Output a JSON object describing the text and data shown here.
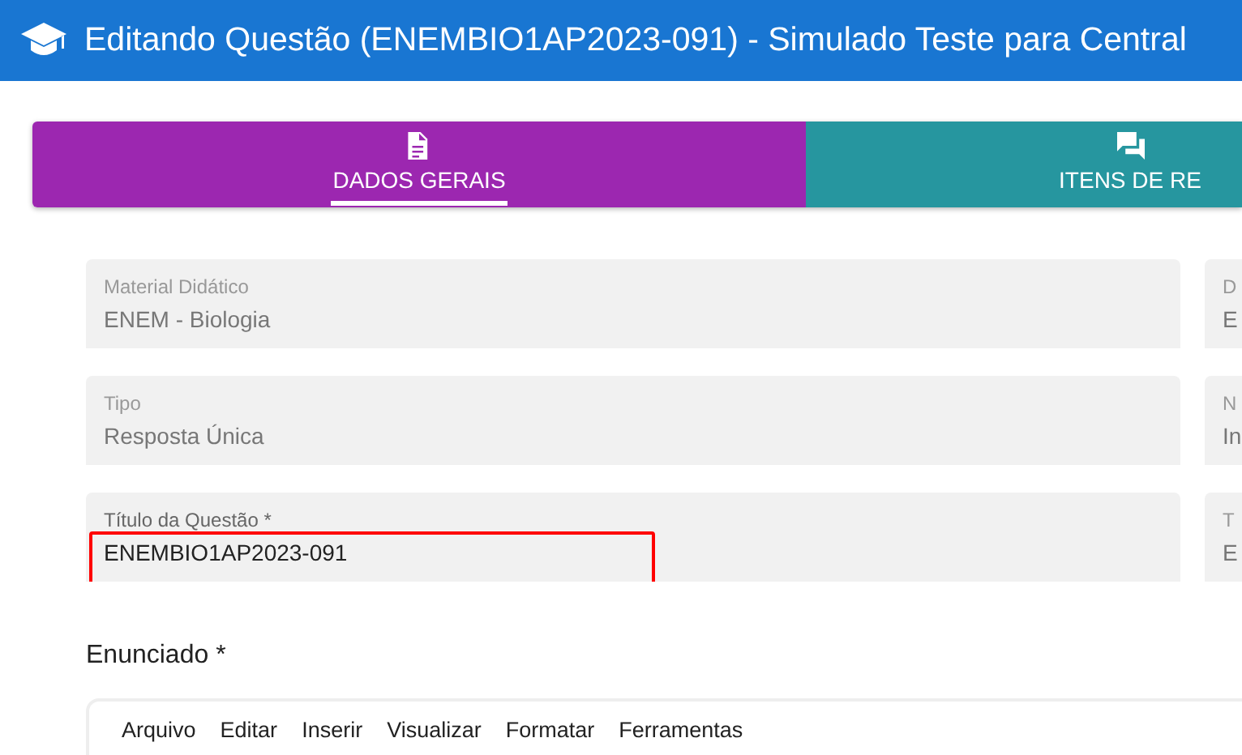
{
  "header": {
    "title": "Editando Questão (ENEMBIO1AP2023-091) - Simulado Teste para Central"
  },
  "tabs": [
    {
      "label": "DADOS GERAIS",
      "selected": true,
      "color": "#9c27b0"
    },
    {
      "label": "ITENS DE RE",
      "selected": false,
      "color": "#26969f"
    }
  ],
  "fields": [
    {
      "label": "Material Didático",
      "value": "ENEM - Biologia",
      "highlight": false,
      "disabled": true
    },
    {
      "label": "D",
      "value": "E",
      "highlight": false,
      "disabled": true
    },
    {
      "label": "Tipo",
      "value": "Resposta Única",
      "highlight": false,
      "disabled": true
    },
    {
      "label": "N",
      "value": "In",
      "highlight": false,
      "disabled": true
    },
    {
      "label": "Título da Questão *",
      "value": "ENEMBIO1AP2023-091",
      "highlight": true,
      "disabled": false
    },
    {
      "label": "T",
      "value": "E",
      "highlight": false,
      "disabled": true
    }
  ],
  "statement": {
    "label": "Enunciado *",
    "menu": [
      "Arquivo",
      "Editar",
      "Inserir",
      "Visualizar",
      "Formatar",
      "Ferramentas"
    ]
  }
}
